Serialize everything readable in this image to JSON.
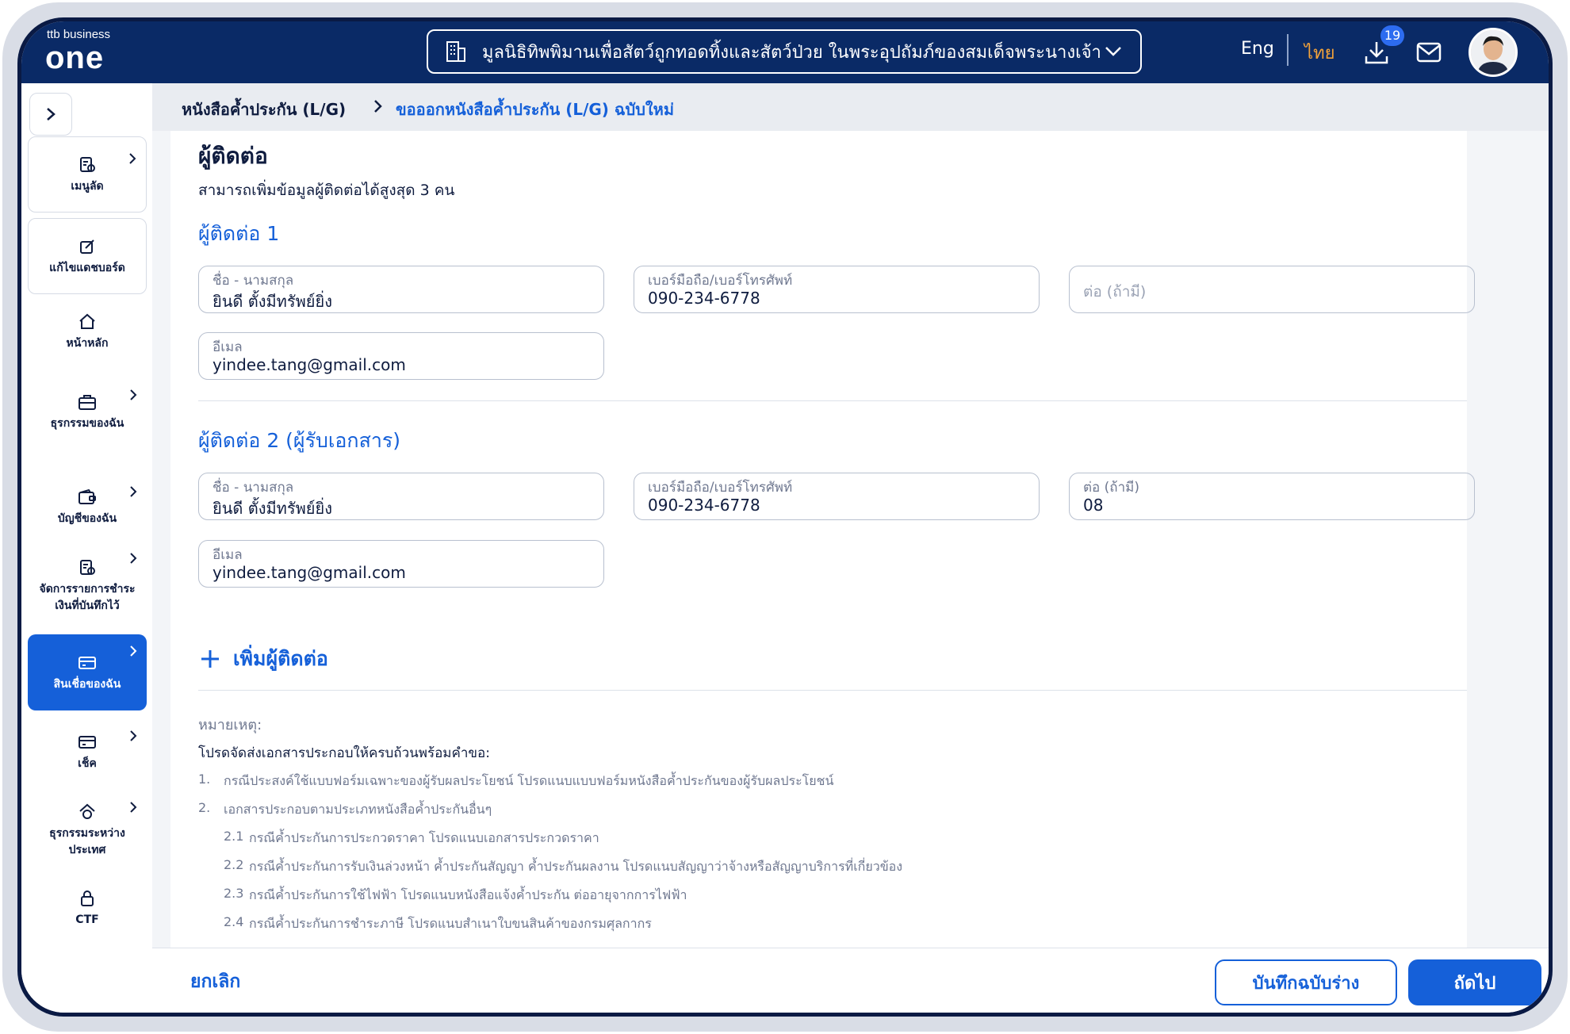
{
  "header": {
    "brand_small": "ttb business",
    "brand_big": "one",
    "org_name": "มูลนิธิทิพพิมานเพื่อสัตว์ถูกทอดทิ้งและสัตว์ป่วย ในพระอุปถัมภ์ของสมเด็จพระนางเจ้า...",
    "lang_en": "Eng",
    "lang_th": "ไทย",
    "download_badge": "19",
    "icons": [
      "building-icon",
      "chevron-down-icon",
      "download-icon",
      "mail-icon",
      "avatar"
    ]
  },
  "sidebar": {
    "items": [
      {
        "label": "เมนูลัด",
        "icon": "shortcut-icon"
      },
      {
        "label": "แก้ไขแดชบอร์ด",
        "icon": "edit-icon"
      },
      {
        "label": "หน้าหลัก",
        "icon": "home-icon"
      },
      {
        "label": "ธุรกรรมของฉัน",
        "icon": "briefcase-icon"
      },
      {
        "label": "บัญชีของฉัน",
        "icon": "wallet-icon"
      },
      {
        "label": "จัดการรายการชำระเงินที่บันทึกไว้",
        "icon": "document-icon"
      },
      {
        "label": "สินเชื่อของฉัน",
        "icon": "card-icon"
      },
      {
        "label": "เช็ค",
        "icon": "cheque-icon"
      },
      {
        "label": "ธุรกรรมระหว่างประเทศ",
        "icon": "globe-icon"
      },
      {
        "label": "CTF",
        "icon": "lock-icon"
      }
    ],
    "active_color": "#1560d9"
  },
  "breadcrumb": {
    "parent": "หนังสือค้ำประกัน (L/G)",
    "current": "ขอออกหนังสือค้ำประกัน (L/G) ฉบับใหม่"
  },
  "section": {
    "title": "ผู้ติดต่อ",
    "subtitle": "สามารถเพิ่มข้อมูลผู้ติดต่อได้สูงสุด 3 คน"
  },
  "contacts": [
    {
      "heading": "ผู้ติดต่อ 1",
      "name_label": "ชื่อ - นามสกุล",
      "name_value": "ยินดี ตั้งมีทรัพย์ยิ่ง",
      "phone_label": "เบอร์มือถือ/เบอร์โทรศัพท์",
      "phone_value": "090-234-6778",
      "ext_placeholder": "ต่อ (ถ้ามี)",
      "email_label": "อีเมล",
      "email_value": "yindee.tang@gmail.com"
    },
    {
      "heading": "ผู้ติดต่อ 2 (ผู้รับเอกสาร)",
      "name_label": "ชื่อ - นามสกุล",
      "name_value": "ยินดี ตั้งมีทรัพย์ยิ่ง",
      "phone_label": "เบอร์มือถือ/เบอร์โทรศัพท์",
      "phone_value": "090-234-6778",
      "ext_label": "ต่อ (ถ้ามี)",
      "ext_value": "08",
      "email_label": "อีเมล",
      "email_value": "yindee.tang@gmail.com"
    }
  ],
  "add_contact": "เพิ่มผู้ติดต่อ",
  "notes": {
    "heading": "หมายเหตุ:",
    "intro": "โปรดจัดส่งเอกสารประกอบให้ครบถ้วนพร้อมคำขอ:",
    "lines": [
      {
        "num": "1.",
        "text": "กรณีประสงค์ใช้แบบฟอร์มเฉพาะของผู้รับผลประโยชน์ โปรดแนบแบบฟอร์มหนังสือค้ำประกันของผู้รับผลประโยชน์"
      },
      {
        "num": "2.",
        "text": "เอกสารประกอบตามประเภทหนังสือค้ำประกันอื่นๆ"
      },
      {
        "num": "2.1",
        "text": "กรณีค้ำประกันการประกวดราคา โปรดแนบเอกสารประกวดราคา"
      },
      {
        "num": "2.2",
        "text": "กรณีค้ำประกันการรับเงินล่วงหน้า ค้ำประกันสัญญา ค้ำประกันผลงาน โปรดแนบสัญญาว่าจ้างหรือสัญญาบริการที่เกี่ยวข้อง"
      },
      {
        "num": "2.3",
        "text": "กรณีค้ำประกันการใช้ไฟฟ้า โปรดแนบหนังสือแจ้งค้ำประกัน ต่ออายุจากการไฟฟ้า"
      },
      {
        "num": "2.4",
        "text": "กรณีค้ำประกันการชำระภาษี โปรดแนบสำเนาใบขนสินค้าของกรมศุลกากร"
      }
    ]
  },
  "footer": {
    "cancel": "ยกเลิก",
    "save_draft": "บันทึกฉบับร่าง",
    "next": "ถัดไป"
  }
}
